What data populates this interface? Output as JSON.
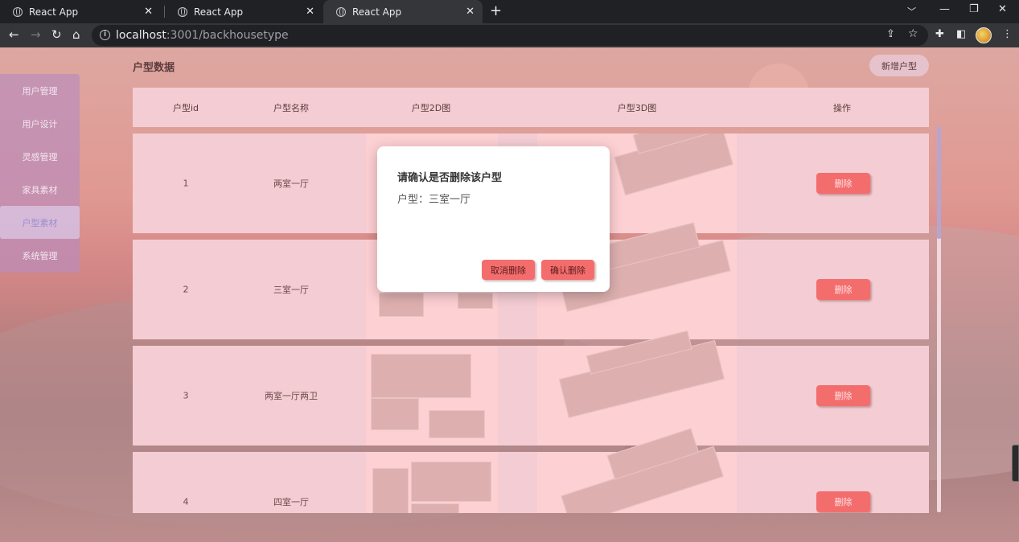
{
  "browser": {
    "tabs": [
      {
        "title": "React App",
        "active": false
      },
      {
        "title": "React App",
        "active": false
      },
      {
        "title": "React App",
        "active": true
      }
    ],
    "url_host": "localhost",
    "url_rest": ":3001/backhousetype"
  },
  "sidebar": {
    "items": [
      {
        "label": "用户管理",
        "active": false
      },
      {
        "label": "用户设计",
        "active": false
      },
      {
        "label": "灵感管理",
        "active": false
      },
      {
        "label": "家具素材",
        "active": false
      },
      {
        "label": "户型素材",
        "active": true
      },
      {
        "label": "系统管理",
        "active": false
      }
    ]
  },
  "header": {
    "title": "户型数据",
    "add_button": "新增户型"
  },
  "table": {
    "columns": [
      "户型id",
      "户型名称",
      "户型2D图",
      "户型3D图",
      "操作"
    ],
    "rows": [
      {
        "id": "1",
        "name": "两室一厅",
        "action": "删除"
      },
      {
        "id": "2",
        "name": "三室一厅",
        "action": "删除"
      },
      {
        "id": "3",
        "name": "两室一厅两卫",
        "action": "删除"
      },
      {
        "id": "4",
        "name": "四室一厅",
        "action": "删除"
      }
    ]
  },
  "modal": {
    "title": "请确认是否删除该户型",
    "body": "户型：三室一厅",
    "cancel": "取消删除",
    "confirm": "确认删除"
  },
  "colors": {
    "accent": "#f46d6d",
    "sidebar_active_text": "#9a8cd4"
  }
}
